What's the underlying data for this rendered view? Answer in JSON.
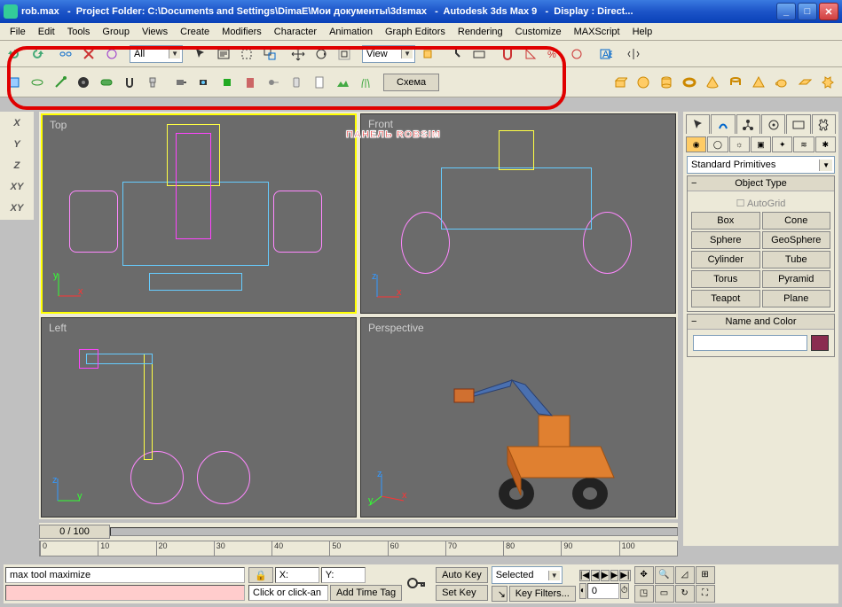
{
  "window": {
    "filename": "rob.max",
    "project_label": "Project Folder: C:\\Documents and Settings\\DimaE\\Мои документы\\3dsmax",
    "app": "Autodesk 3ds Max 9",
    "display": "Display : Direct..."
  },
  "menu": [
    "File",
    "Edit",
    "Tools",
    "Group",
    "Views",
    "Create",
    "Modifiers",
    "Character",
    "Animation",
    "Graph Editors",
    "Rendering",
    "Customize",
    "MAXScript",
    "Help"
  ],
  "toolbar1": {
    "selection_filter": "All",
    "ref_coord": "View"
  },
  "robsim": {
    "button_label": "Схема",
    "overlay_label": "ПАНЕЛЬ ROBSIM"
  },
  "left_axis_buttons": [
    "X",
    "Y",
    "Z",
    "XY",
    "XY"
  ],
  "viewports": {
    "top": "Top",
    "front": "Front",
    "left": "Left",
    "perspective": "Perspective"
  },
  "command_panel": {
    "dropdown": "Standard Primitives",
    "rollout_object_type": "Object Type",
    "autogrid": "AutoGrid",
    "primitives": [
      [
        "Box",
        "Cone"
      ],
      [
        "Sphere",
        "GeoSphere"
      ],
      [
        "Cylinder",
        "Tube"
      ],
      [
        "Torus",
        "Pyramid"
      ],
      [
        "Teapot",
        "Plane"
      ]
    ],
    "rollout_name": "Name and Color",
    "name_value": "",
    "swatch_color": "#8a2c50"
  },
  "timeline": {
    "position": "0 / 100",
    "ticks": [
      "0",
      "10",
      "20",
      "30",
      "40",
      "50",
      "60",
      "70",
      "80",
      "90",
      "100"
    ]
  },
  "status": {
    "listener": "max tool maximize",
    "prompt": "Click or click-an",
    "add_tag": "Add Time Tag",
    "x_label": "X:",
    "y_label": "Y:",
    "autokey": "Auto Key",
    "setkey": "Set Key",
    "selected": "Selected",
    "keyfilters": "Key Filters...",
    "framefield": "0"
  }
}
